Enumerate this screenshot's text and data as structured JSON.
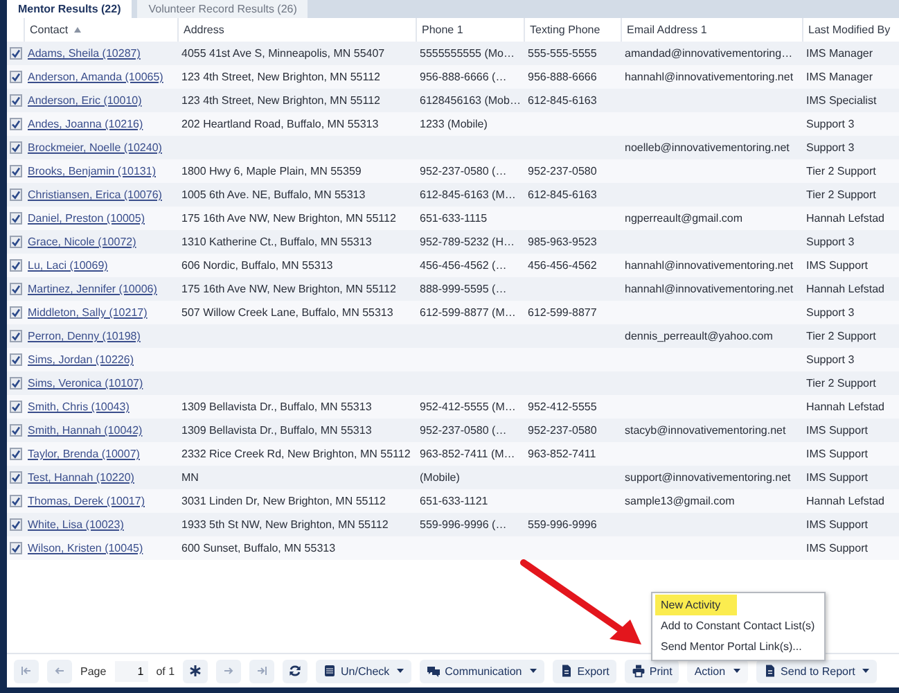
{
  "tabs": [
    {
      "label": "Mentor Results (22)",
      "selected": true
    },
    {
      "label": "Volunteer Record Results (26)",
      "selected": false
    }
  ],
  "table": {
    "columns": [
      {
        "label": "Contact",
        "sorted_ascending": true
      },
      {
        "label": "Address"
      },
      {
        "label": "Phone 1"
      },
      {
        "label": "Texting Phone"
      },
      {
        "label": "Email Address 1"
      },
      {
        "label": "Last Modified By"
      }
    ],
    "rows": [
      {
        "checked": true,
        "contact": "Adams, Sheila (10287)",
        "address": "4055 41st Ave S, Minneapolis, MN 55407",
        "phone_1": "5555555555 (Mo…",
        "texting_phone": "555-555-5555",
        "email": "amandad@innovativementoring…",
        "last_modified_by": "IMS Manager"
      },
      {
        "checked": true,
        "contact": "Anderson, Amanda (10065)",
        "address": "123 4th Street, New Brighton, MN 55112",
        "phone_1": "956-888-6666 (…",
        "texting_phone": "956-888-6666",
        "email": "hannahl@innovativementoring.net",
        "last_modified_by": "IMS Manager"
      },
      {
        "checked": true,
        "contact": "Anderson, Eric (10010)",
        "address": "123 4th Street, New Brighton, MN 55112",
        "phone_1": "6128456163 (Mob…",
        "texting_phone": "612-845-6163",
        "last_modified_by": "IMS Specialist"
      },
      {
        "checked": true,
        "contact": "Andes, Joanna (10216)",
        "address": "202 Heartland Road, Buffalo, MN 55313",
        "phone_1": "1233 (Mobile)",
        "last_modified_by": "Support 3"
      },
      {
        "checked": true,
        "contact": "Brockmeier, Noelle (10240)",
        "email": "noelleb@innovativementoring.net",
        "last_modified_by": "Support 3"
      },
      {
        "checked": true,
        "contact": "Brooks, Benjamin (10131)",
        "address": "1800 Hwy 6, Maple Plain, MN 55359",
        "phone_1": "952-237-0580 (…",
        "texting_phone": "952-237-0580",
        "last_modified_by": "Tier 2 Support"
      },
      {
        "checked": true,
        "contact": "Christiansen, Erica (10076)",
        "address": "1005 6th Ave. NE, Buffalo, MN 55313",
        "phone_1": "612-845-6163 (M…",
        "texting_phone": "612-845-6163",
        "last_modified_by": "Tier 2 Support"
      },
      {
        "checked": true,
        "contact": "Daniel, Preston (10005)",
        "address": "175 16th Ave NW, New Brighton, MN 55112",
        "phone_1": "651-633-1115",
        "email": "ngperreault@gmail.com",
        "last_modified_by": "Hannah Lefstad"
      },
      {
        "checked": true,
        "contact": "Grace, Nicole (10072)",
        "address": "1310 Katherine Ct., Buffalo, MN 55313",
        "phone_1": "952-789-5232 (H…",
        "texting_phone": "985-963-9523",
        "last_modified_by": "Support 3"
      },
      {
        "checked": true,
        "contact": "Lu, Laci (10069)",
        "address": "606 Nordic, Buffalo, MN 55313",
        "phone_1": "456-456-4562 (…",
        "texting_phone": "456-456-4562",
        "email": "hannahl@innovativementoring.net",
        "last_modified_by": "IMS Support"
      },
      {
        "checked": true,
        "contact": "Martinez, Jennifer (10006)",
        "address": "175 16th Ave NW, New Brighton, MN 55112",
        "phone_1": "888-999-5595 (…",
        "email": "hannahl@innovativementoring.net",
        "last_modified_by": "Hannah Lefstad"
      },
      {
        "checked": true,
        "contact": "Middleton, Sally (10217)",
        "address": "507 Willow Creek Lane, Buffalo, MN 55313",
        "phone_1": "612-599-8877 (M…",
        "texting_phone": "612-599-8877",
        "last_modified_by": "Support 3"
      },
      {
        "checked": true,
        "contact": "Perron, Denny (10198)",
        "email": "dennis_perreault@yahoo.com",
        "last_modified_by": "Tier 2 Support"
      },
      {
        "checked": true,
        "contact": "Sims, Jordan (10226)",
        "last_modified_by": "Support 3"
      },
      {
        "checked": true,
        "contact": "Sims, Veronica (10107)",
        "last_modified_by": "Tier 2 Support"
      },
      {
        "checked": true,
        "contact": "Smith, Chris (10043)",
        "address": "1309 Bellavista Dr., Buffalo, MN 55313",
        "phone_1": "952-412-5555 (M…",
        "texting_phone": "952-412-5555",
        "last_modified_by": "Hannah Lefstad"
      },
      {
        "checked": true,
        "contact": "Smith, Hannah (10042)",
        "address": "1309 Bellavista Dr., Buffalo, MN 55313",
        "phone_1": "952-237-0580 (…",
        "texting_phone": "952-237-0580",
        "email": "stacyb@innovativementoring.net",
        "last_modified_by": "IMS Support"
      },
      {
        "checked": true,
        "contact": "Taylor, Brenda (10007)",
        "address": "2332 Rice Creek Rd, New Brighton, MN 55112",
        "phone_1": "963-852-7411 (M…",
        "texting_phone": "963-852-7411",
        "last_modified_by": "IMS Support"
      },
      {
        "checked": true,
        "contact": "Test, Hannah (10220)",
        "address": "MN",
        "phone_1": "(Mobile)",
        "email": "support@innovativementoring.net",
        "last_modified_by": "IMS Support"
      },
      {
        "checked": true,
        "contact": "Thomas, Derek (10017)",
        "address": "3031 Linden Dr, New Brighton, MN 55112",
        "phone_1": "651-633-1121",
        "email": "sample13@gmail.com",
        "last_modified_by": "Hannah Lefstad"
      },
      {
        "checked": true,
        "contact": "White, Lisa (10023)",
        "address": "1933 5th St NW, New Brighton, MN 55112",
        "phone_1": "559-996-9996 (…",
        "texting_phone": "559-996-9996",
        "last_modified_by": "IMS Support"
      },
      {
        "checked": true,
        "contact": "Wilson, Kristen (10045)",
        "address": "600 Sunset, Buffalo, MN 55313",
        "last_modified_by": "IMS Support"
      }
    ]
  },
  "toolbar": [
    {
      "kind": "first",
      "disabled": true
    },
    {
      "kind": "prev",
      "disabled": true
    },
    {
      "kind": "pager",
      "label": "Page",
      "value": "1",
      "total": "of 1"
    },
    {
      "kind": "asterisk",
      "disabled": false
    },
    {
      "kind": "next",
      "disabled": true
    },
    {
      "kind": "last",
      "disabled": true
    },
    {
      "kind": "refresh",
      "disabled": false
    },
    {
      "kind": "list",
      "label": "Un/Check",
      "dropdown": true
    },
    {
      "kind": "chat",
      "label": "Communication",
      "dropdown": true
    },
    {
      "kind": "file",
      "label": "Export",
      "dropdown": false
    },
    {
      "kind": "print",
      "label": "Print",
      "dropdown": false
    },
    {
      "kind": "plain",
      "label": "Action",
      "dropdown": true
    },
    {
      "kind": "file",
      "label": "Send to Report",
      "dropdown": true
    }
  ],
  "action_menu": {
    "items": [
      {
        "label": "New Activity",
        "highlighted": true
      },
      {
        "label": "Add to Constant Contact List(s)",
        "highlighted": false
      },
      {
        "label": "Send Mentor Portal Link(s)...",
        "highlighted": false
      }
    ]
  },
  "annotation": {
    "kind": "arrow"
  }
}
